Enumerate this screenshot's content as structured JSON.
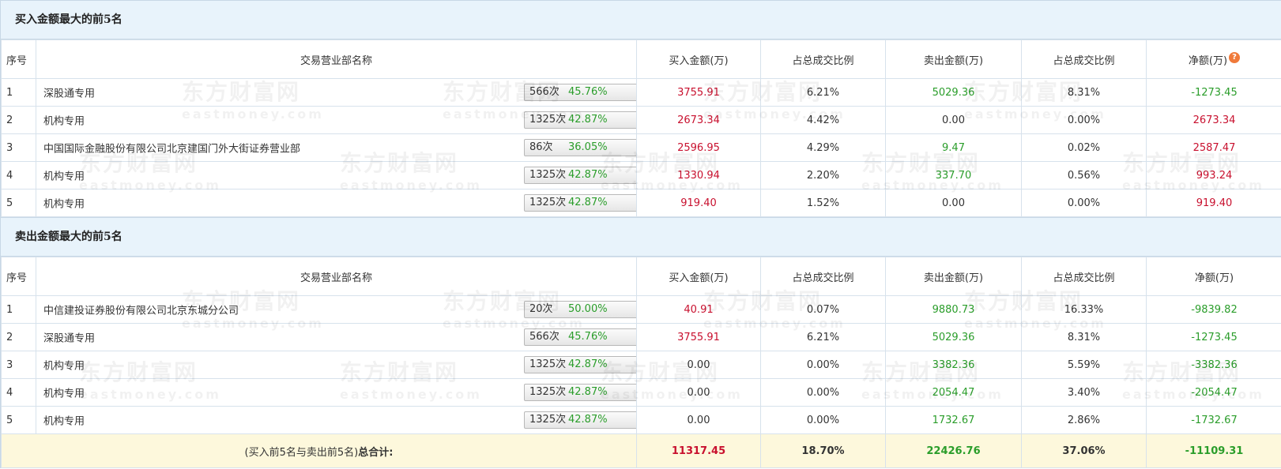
{
  "buy_section": {
    "title": "买入金额最大的前5名",
    "headers": {
      "idx": "序号",
      "name": "交易营业部名称",
      "buy": "买入金额(万)",
      "buy_ratio": "占总成交比例",
      "sell": "卖出金额(万)",
      "sell_ratio": "占总成交比例",
      "net": "净额(万)"
    },
    "rows": [
      {
        "idx": "1",
        "name": "深股通专用",
        "times": "566次",
        "pct": "45.76%",
        "icon": "question-icon",
        "buy": "3755.91",
        "buy_ratio": "6.21%",
        "sell": "5029.36",
        "sell_ratio": "8.31%",
        "net": "-1273.45"
      },
      {
        "idx": "2",
        "name": "机构专用",
        "times": "1325次",
        "pct": "42.87%",
        "icon": "arrow-right-icon",
        "buy": "2673.34",
        "buy_ratio": "4.42%",
        "sell": "0.00",
        "sell_ratio": "0.00%",
        "net": "2673.34"
      },
      {
        "idx": "3",
        "name": "中国国际金融股份有限公司北京建国门外大街证券营业部",
        "times": "86次",
        "pct": "36.05%",
        "icon": "arrow-right-icon",
        "buy": "2596.95",
        "buy_ratio": "4.29%",
        "sell": "9.47",
        "sell_ratio": "0.02%",
        "net": "2587.47"
      },
      {
        "idx": "4",
        "name": "机构专用",
        "times": "1325次",
        "pct": "42.87%",
        "icon": "arrow-right-icon",
        "buy": "1330.94",
        "buy_ratio": "2.20%",
        "sell": "337.70",
        "sell_ratio": "0.56%",
        "net": "993.24"
      },
      {
        "idx": "5",
        "name": "机构专用",
        "times": "1325次",
        "pct": "42.87%",
        "icon": "arrow-right-icon",
        "buy": "919.40",
        "buy_ratio": "1.52%",
        "sell": "0.00",
        "sell_ratio": "0.00%",
        "net": "919.40"
      }
    ]
  },
  "sell_section": {
    "title": "卖出金额最大的前5名",
    "headers": {
      "idx": "序号",
      "name": "交易营业部名称",
      "buy": "买入金额(万)",
      "buy_ratio": "占总成交比例",
      "sell": "卖出金额(万)",
      "sell_ratio": "占总成交比例",
      "net": "净额(万)"
    },
    "rows": [
      {
        "idx": "1",
        "name": "中信建投证券股份有限公司北京东城分公司",
        "times": "20次",
        "pct": "50.00%",
        "icon": "question-icon",
        "buy": "40.91",
        "buy_ratio": "0.07%",
        "sell": "9880.73",
        "sell_ratio": "16.33%",
        "net": "-9839.82"
      },
      {
        "idx": "2",
        "name": "深股通专用",
        "times": "566次",
        "pct": "45.76%",
        "icon": "arrow-right-icon",
        "buy": "3755.91",
        "buy_ratio": "6.21%",
        "sell": "5029.36",
        "sell_ratio": "8.31%",
        "net": "-1273.45"
      },
      {
        "idx": "3",
        "name": "机构专用",
        "times": "1325次",
        "pct": "42.87%",
        "icon": "arrow-right-icon",
        "buy": "0.00",
        "buy_ratio": "0.00%",
        "sell": "3382.36",
        "sell_ratio": "5.59%",
        "net": "-3382.36"
      },
      {
        "idx": "4",
        "name": "机构专用",
        "times": "1325次",
        "pct": "42.87%",
        "icon": "arrow-right-icon",
        "buy": "0.00",
        "buy_ratio": "0.00%",
        "sell": "2054.47",
        "sell_ratio": "3.40%",
        "net": "-2054.47"
      },
      {
        "idx": "5",
        "name": "机构专用",
        "times": "1325次",
        "pct": "42.87%",
        "icon": "arrow-right-icon",
        "buy": "0.00",
        "buy_ratio": "0.00%",
        "sell": "1732.67",
        "sell_ratio": "2.86%",
        "net": "-1732.67"
      }
    ]
  },
  "total": {
    "label_prefix": "(买入前5名与卖出前5名)",
    "label_bold": "总合计:",
    "buy": "11317.45",
    "buy_ratio": "18.70%",
    "sell": "22426.76",
    "sell_ratio": "37.06%",
    "net": "-11109.31"
  },
  "watermark": {
    "text_cn": "东方财富网",
    "text_en": "eastmoney.com"
  },
  "colors": {
    "positive": "#c8102e",
    "negative": "#2a9d2a",
    "header_bg": "#e8f3fb",
    "total_bg": "#fdf8dc"
  }
}
